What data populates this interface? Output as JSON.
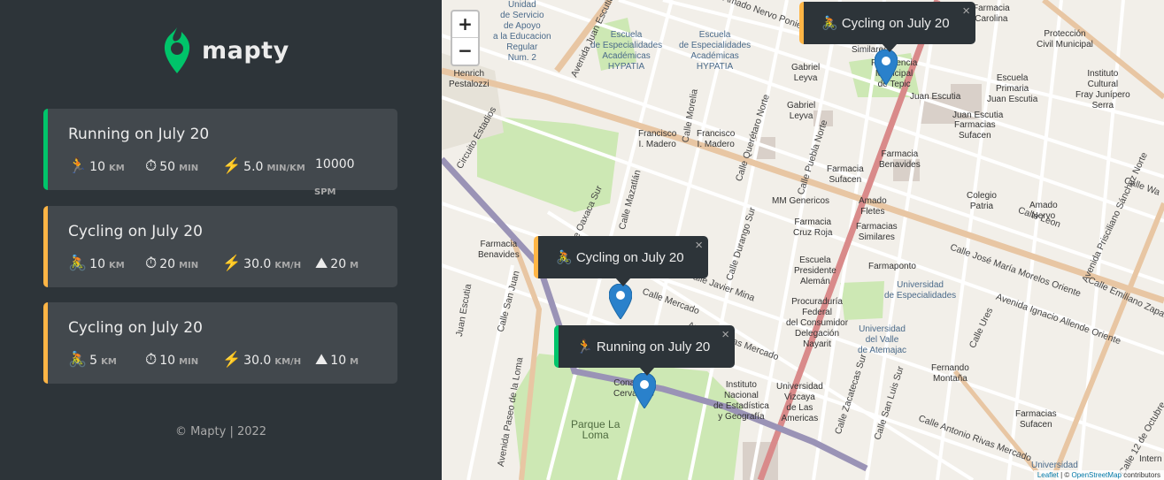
{
  "brand": {
    "name": "mapty"
  },
  "workouts": [
    {
      "title": "Running on July 20",
      "type": "running",
      "stats": [
        {
          "icon": "🏃",
          "value": "10",
          "unit": "KM"
        },
        {
          "icon": "⏱",
          "value": "50",
          "unit": "MIN"
        },
        {
          "icon": "⚡️",
          "value": "5.0",
          "unit": "MIN/KM"
        },
        {
          "icon": "",
          "value": "10000",
          "unit": "SPM"
        }
      ]
    },
    {
      "title": "Cycling on July 20",
      "type": "cycling",
      "stats": [
        {
          "icon": "🚴",
          "value": "10",
          "unit": "KM"
        },
        {
          "icon": "⏱",
          "value": "20",
          "unit": "MIN"
        },
        {
          "icon": "⚡️",
          "value": "30.0",
          "unit": "KM/H"
        },
        {
          "icon": "⛰",
          "value": "20",
          "unit": "M"
        }
      ]
    },
    {
      "title": "Cycling on July 20",
      "type": "cycling",
      "stats": [
        {
          "icon": "🚴",
          "value": "5",
          "unit": "KM"
        },
        {
          "icon": "⏱",
          "value": "10",
          "unit": "MIN"
        },
        {
          "icon": "⚡️",
          "value": "30.0",
          "unit": "KM/H"
        },
        {
          "icon": "⛰",
          "value": "10",
          "unit": "M"
        }
      ]
    }
  ],
  "footer": "© Mapty | 2022",
  "map": {
    "zoom_in": "+",
    "zoom_out": "−",
    "popups": [
      {
        "text": "🚴 Cycling on July 20",
        "close": "×"
      },
      {
        "text": "🚴 Cycling on July 20",
        "close": "×"
      },
      {
        "text": "🏃 Running on July 20",
        "close": "×"
      }
    ],
    "attribution": {
      "leaflet": "Leaflet",
      "sep": " | © ",
      "osm": "OpenStreetMap",
      "suffix": " contributors"
    },
    "labels": {
      "l1": "Unidad\nde Servicio\nde Apoyo\na la Educacion\nRegular\nNum. 2",
      "l2": "Escuela\nde Especialidades\nAcadémicas\nHYPATIA",
      "l3": "Escuela\nde Especialidades\nAcadémicas\nHYPATIA",
      "l4": "Henrich\nPestalozzi",
      "l5": "Francisco\nI. Madero",
      "l6": "Francisco\nI. Madero",
      "l7": "Gabriel\nLeyva",
      "l8": "Gabriel\nLeyva",
      "l9": "Farmacia\nSufacen",
      "l10": "MM Genericos",
      "l11": "Farmacia\nCruz Roja",
      "l12": "Escuela\nPresidente\nAlemán",
      "l13": "Procuraduría\nFederal\ndel Consumidor\nDelegación\nNayarit",
      "l14": "Universidad\nVizcaya\nde Las\nAmericas",
      "l15": "Instituto\nNacional\nde Estadística\ny Geografía",
      "l16": "Farmacia\nBenavides",
      "l17": "Parque La\nLoma",
      "l18": "Amado\nFletes",
      "l19": "Farmacias\nSimilares",
      "l20": "Farmaponto",
      "l21": "Universidad\nde Especialidades",
      "l22": "Universidad\ndel Valle\nde Atemajac",
      "l23": "Fernando\nMontaña",
      "l24": "Colegio\nPatria",
      "l25": "Amado\nNervo",
      "l26": "Escuela\nPrimaria\nJuan Escutia",
      "l27": "Juan Escutia",
      "l28": "Juan Escutia",
      "l29": "Farmacias\nSufacen",
      "l30": "Farmacia\nBenavides",
      "l31": "Instituto\nCultural\nFray Junípero\nSerra",
      "l32": "Protección\nCivil Municipal",
      "l33": "Farmacias\nSufacen",
      "l34": "Similares",
      "l35": "Presidencia\nMunicipal\nde Tepic",
      "l36": "Farmacia\nCarolina",
      "l37": "Universidad",
      "l38": "Intern",
      "l39": "Conaseca\nCervantes"
    },
    "streets": {
      "s1": "Avenida Juan Escutia",
      "s2": "Calle Morelia",
      "s3": "Calle Querétaro Norte",
      "s4": "Calle Puebla Norte",
      "s5": "Calle Mazatlán",
      "s6": "Calle Durango Sur",
      "s7": "Calle Javier Mina",
      "s8": "Calle Zacatecas Sur",
      "s9": "Calle San Luis Sur",
      "s10": "Calle José María Morelos Oriente",
      "s11": "Avenida Ignacio Allende Oriente",
      "s12": "Calle Emiliano Zapata",
      "s13": "Calle Antonio Rivas Mercado",
      "s14": "Antonio Rivas Mercado",
      "s15": "Calle Ures",
      "s16": "Avenida Prisciliano Sánchez Norte",
      "s17": "Calle 12 de Octubre",
      "s18": "Calle San Juan",
      "s19": "Juan Escutia",
      "s20": "Avenida Paseo de la Loma",
      "s21": "Circuito Estadios",
      "s22": "Amado Nervo Poniente",
      "s23": "Calle Oaxaca Sur",
      "s24": "Calle Mercado",
      "s25": "Calle Leon",
      "s26": "Calle Wa"
    }
  }
}
